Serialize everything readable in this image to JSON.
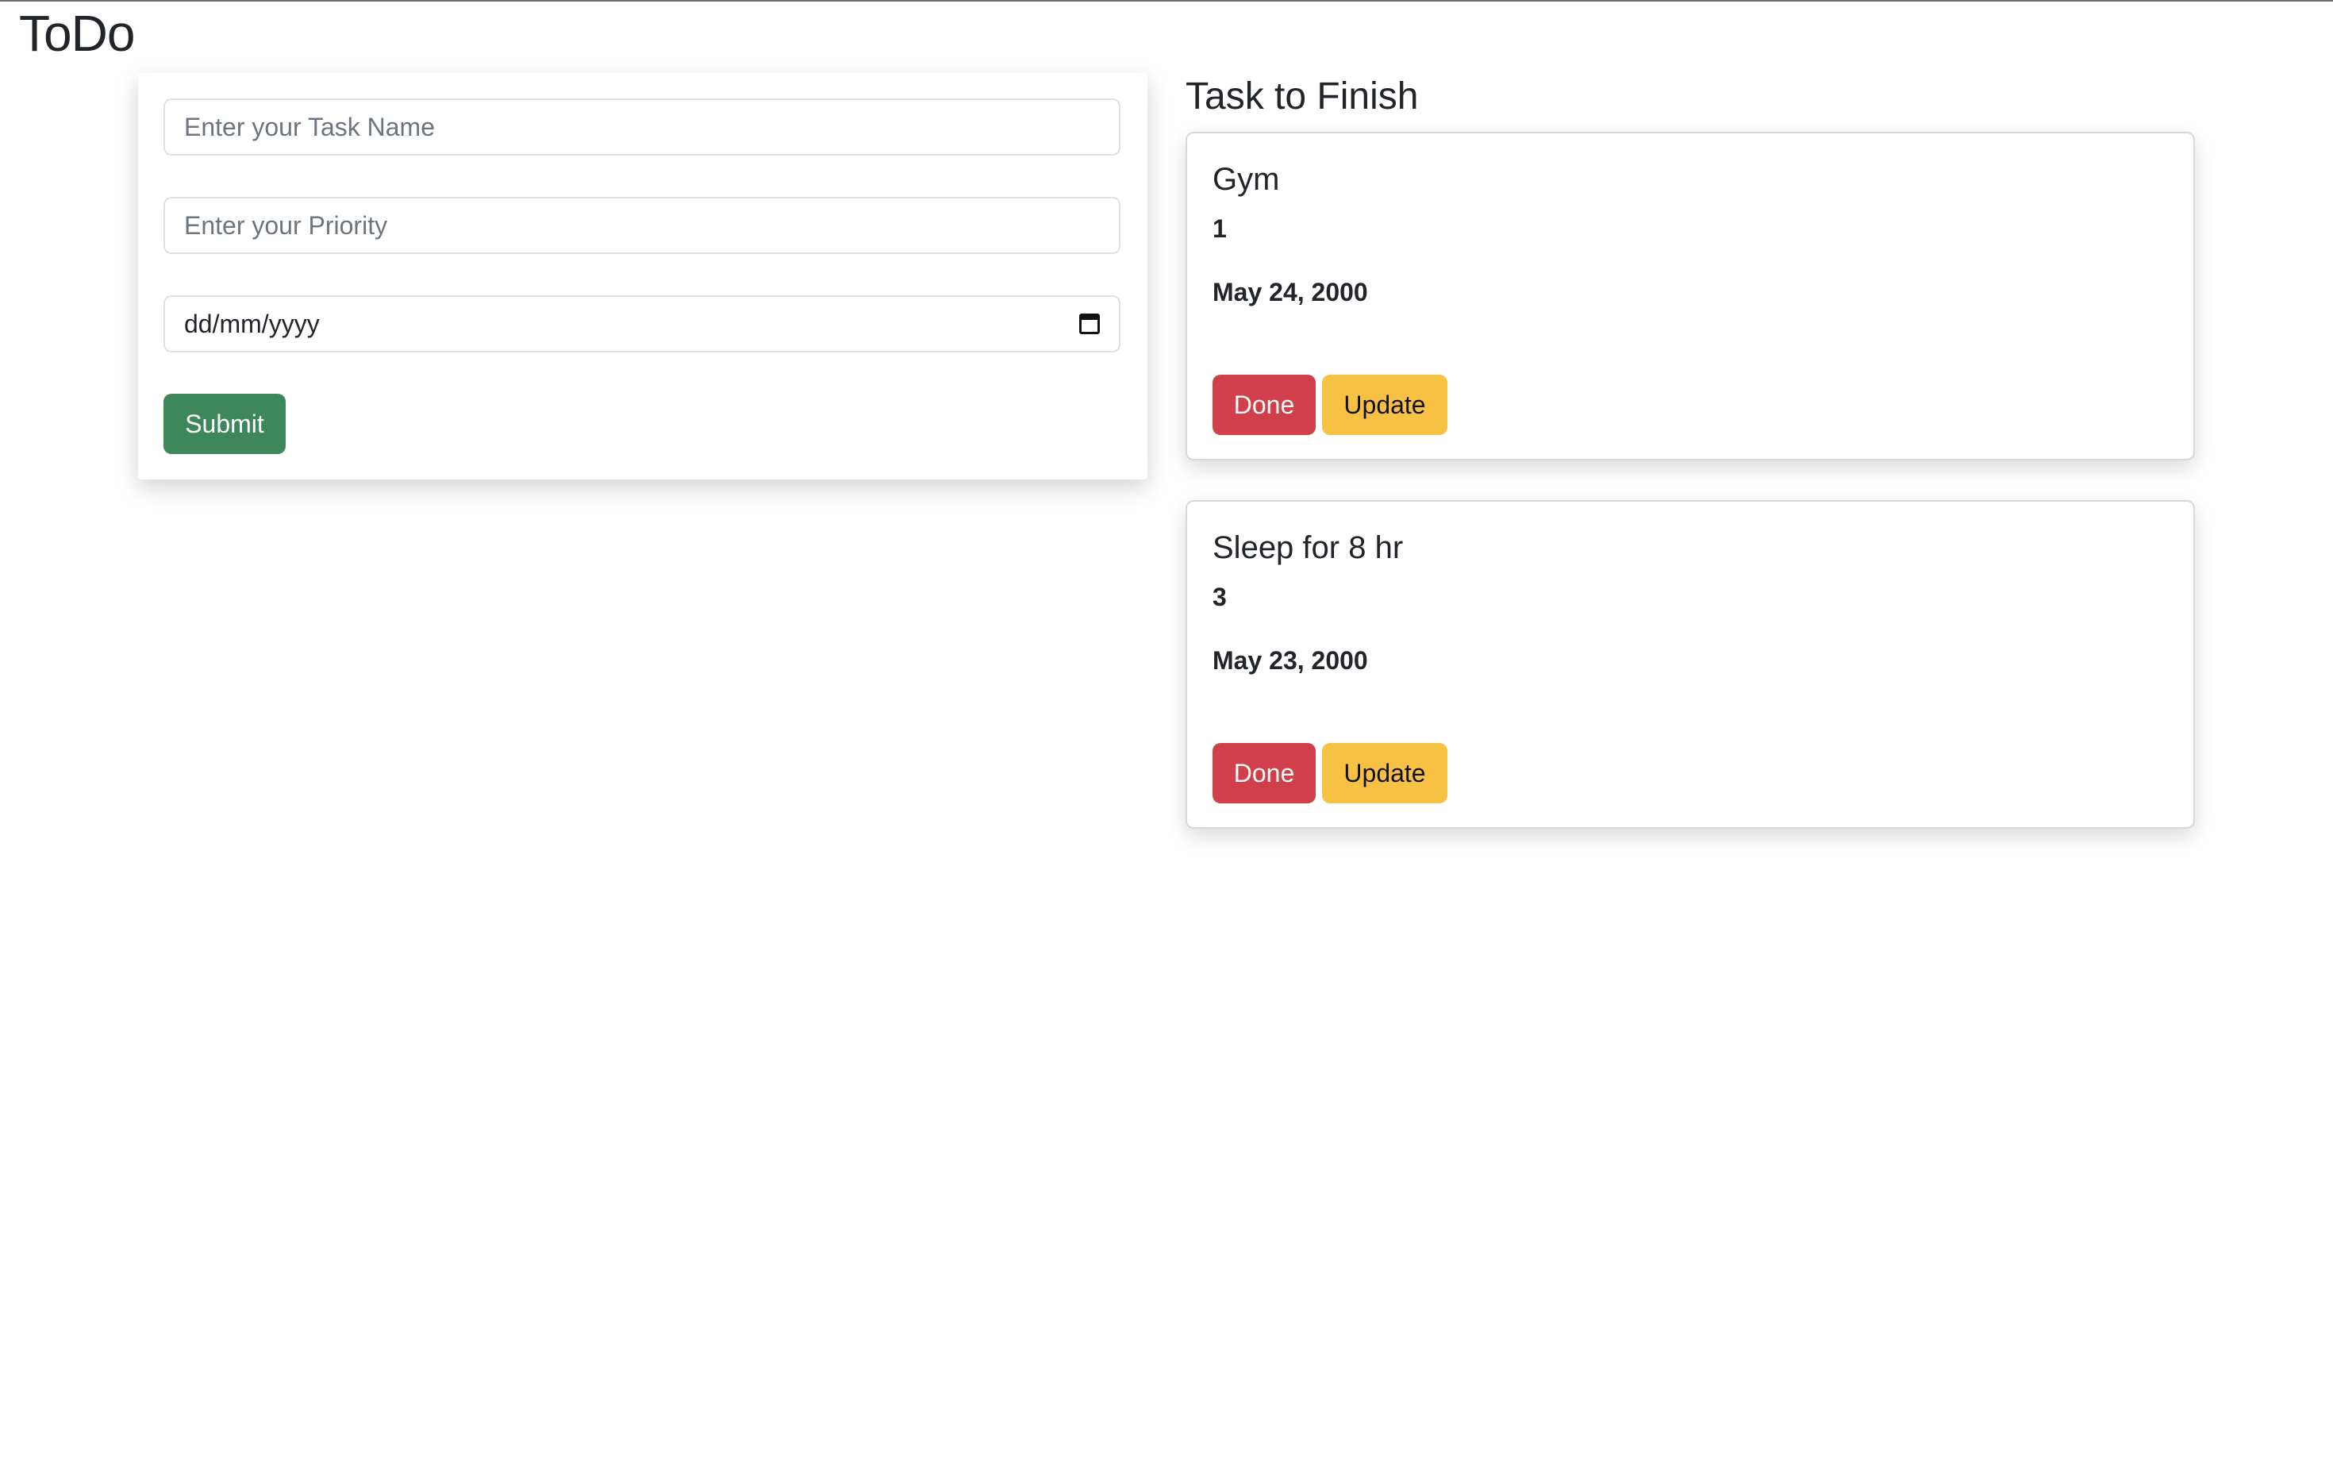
{
  "app": {
    "title": "ToDo"
  },
  "form": {
    "task_name_placeholder": "Enter your Task Name",
    "priority_placeholder": "Enter your Priority",
    "date_placeholder": "dd/mm/yyyy",
    "submit_label": "Submit"
  },
  "tasks_section": {
    "title": "Task to Finish",
    "tasks": [
      {
        "name": "Gym",
        "priority": "1",
        "date": "May 24, 2000",
        "done_label": "Done",
        "update_label": "Update"
      },
      {
        "name": "Sleep for 8 hr",
        "priority": "3",
        "date": "May 23, 2000",
        "done_label": "Done",
        "update_label": "Update"
      }
    ]
  },
  "colors": {
    "submit": "#3e875a",
    "done": "#d1404a",
    "update": "#f7c244"
  }
}
